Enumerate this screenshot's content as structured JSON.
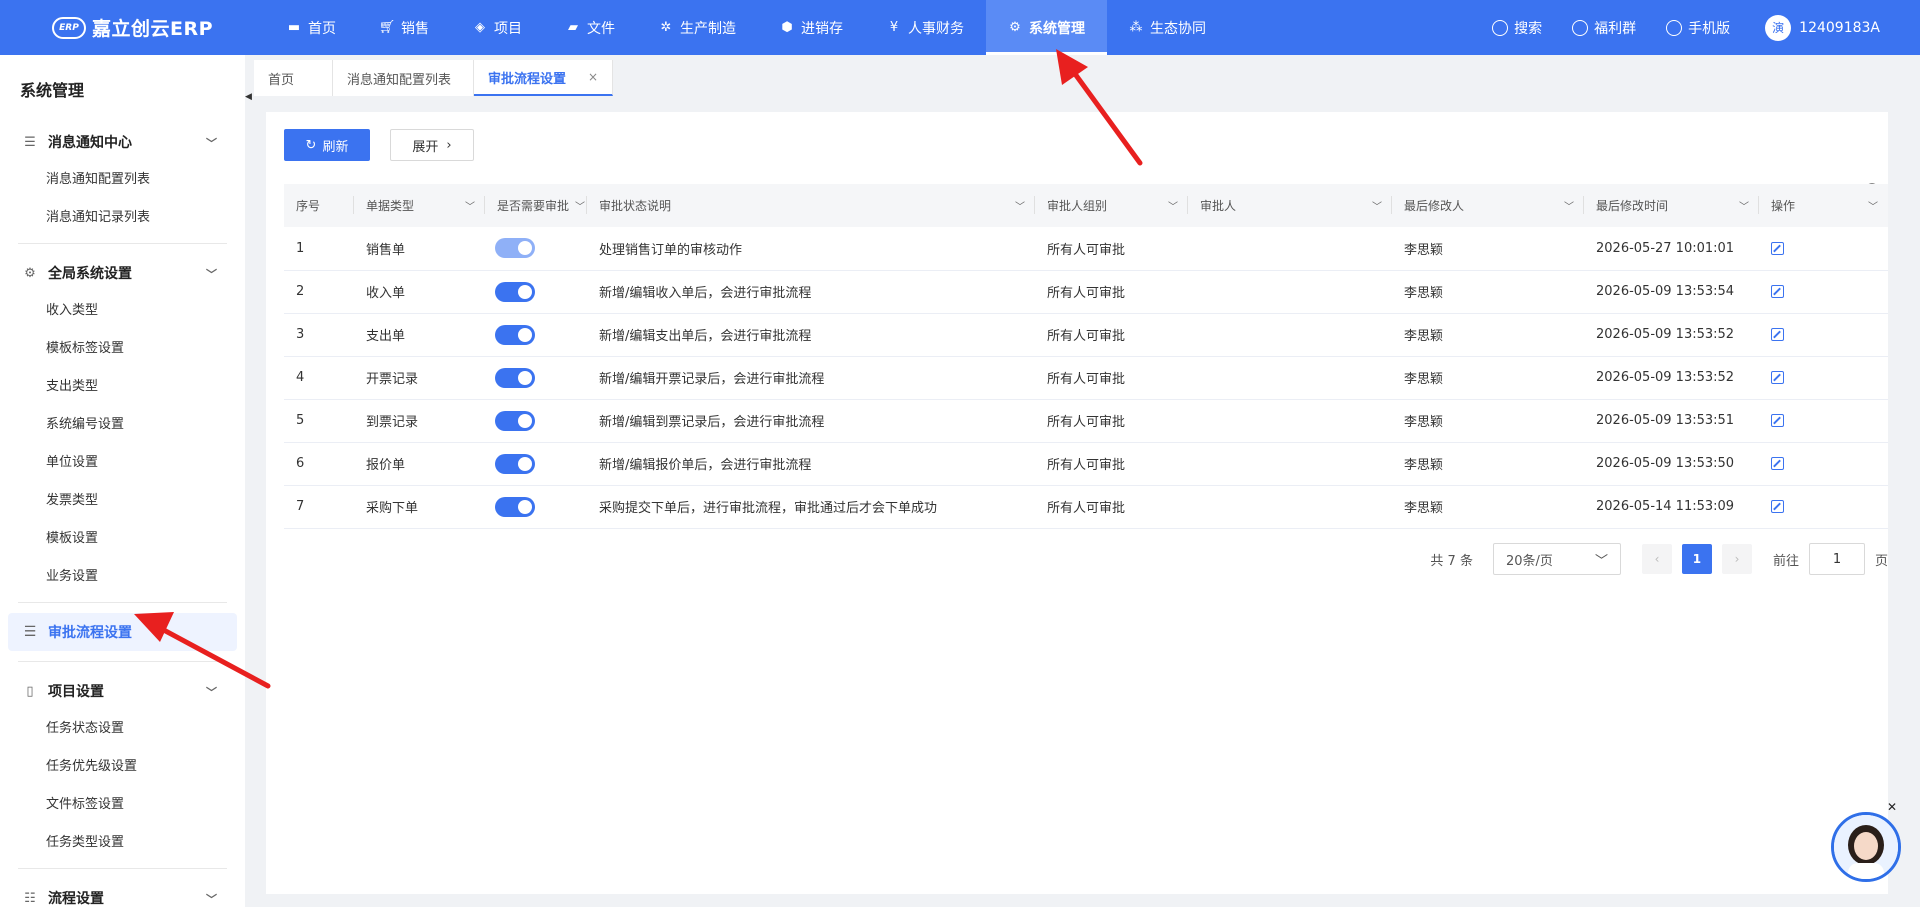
{
  "brand": {
    "logo_mark": "ERP",
    "name": "嘉立创云ERP"
  },
  "nav": [
    {
      "label": "首页",
      "icon": "monitor-icon"
    },
    {
      "label": "销售",
      "icon": "cart-icon"
    },
    {
      "label": "项目",
      "icon": "layers-icon"
    },
    {
      "label": "文件",
      "icon": "folder-icon"
    },
    {
      "label": "生产制造",
      "icon": "chip-icon"
    },
    {
      "label": "进销存",
      "icon": "box-icon"
    },
    {
      "label": "人事财务",
      "icon": "finance-icon"
    },
    {
      "label": "系统管理",
      "icon": "gear-icon",
      "active": true
    },
    {
      "label": "生态协同",
      "icon": "cluster-icon"
    }
  ],
  "topright": {
    "search": "搜索",
    "welfare": "福利群",
    "mobile": "手机版",
    "avatar": "演",
    "user": "12409183A"
  },
  "sidebar": {
    "title": "系统管理",
    "groups": [
      {
        "label": "消息通知中心",
        "items": [
          "消息通知配置列表",
          "消息通知记录列表"
        ]
      },
      {
        "label": "全局系统设置",
        "items": [
          "收入类型",
          "模板标签设置",
          "支出类型",
          "系统编号设置",
          "单位设置",
          "发票类型",
          "模板设置",
          "业务设置"
        ]
      },
      {
        "label": "审批流程设置",
        "active": true
      },
      {
        "label": "项目设置",
        "items": [
          "任务状态设置",
          "任务优先级设置",
          "文件标签设置",
          "任务类型设置"
        ]
      },
      {
        "label": "流程设置"
      }
    ]
  },
  "tabs": {
    "t1": "首页",
    "t2": "消息通知配置列表",
    "t3": "审批流程设置",
    "close": "×"
  },
  "toolbar": {
    "refresh": "刷新",
    "expand": "展开"
  },
  "table": {
    "headers": [
      "序号",
      "单据类型",
      "是否需要审批",
      "审批状态说明",
      "审批人组别",
      "审批人",
      "最后修改人",
      "最后修改时间",
      "操作"
    ],
    "rows": [
      {
        "no": "1",
        "type": "销售单",
        "on": true,
        "desc": "处理销售订单的审核动作",
        "group": "所有人可审批",
        "approver": "",
        "modifier": "李思颖",
        "time": "2026-05-27 10:01:01"
      },
      {
        "no": "2",
        "type": "收入单",
        "on": true,
        "desc": "新增/编辑收入单后，会进行审批流程",
        "group": "所有人可审批",
        "approver": "",
        "modifier": "李思颖",
        "time": "2026-05-09 13:53:54"
      },
      {
        "no": "3",
        "type": "支出单",
        "on": true,
        "desc": "新增/编辑支出单后，会进行审批流程",
        "group": "所有人可审批",
        "approver": "",
        "modifier": "李思颖",
        "time": "2026-05-09 13:53:52"
      },
      {
        "no": "4",
        "type": "开票记录",
        "on": true,
        "desc": "新增/编辑开票记录后，会进行审批流程",
        "group": "所有人可审批",
        "approver": "",
        "modifier": "李思颖",
        "time": "2026-05-09 13:53:52"
      },
      {
        "no": "5",
        "type": "到票记录",
        "on": true,
        "desc": "新增/编辑到票记录后，会进行审批流程",
        "group": "所有人可审批",
        "approver": "",
        "modifier": "李思颖",
        "time": "2026-05-09 13:53:51"
      },
      {
        "no": "6",
        "type": "报价单",
        "on": true,
        "desc": "新增/编辑报价单后，会进行审批流程",
        "group": "所有人可审批",
        "approver": "",
        "modifier": "李思颖",
        "time": "2026-05-09 13:53:50"
      },
      {
        "no": "7",
        "type": "采购下单",
        "on": true,
        "desc": "采购提交下单后，进行审批流程，审批通过后才会下单成功",
        "group": "所有人可审批",
        "approver": "",
        "modifier": "李思颖",
        "time": "2026-05-14 11:53:09"
      }
    ]
  },
  "pagination": {
    "total": "共 7 条",
    "page_size": "20条/页",
    "current": "1",
    "goto_label": "前往",
    "goto_value": "1",
    "page_unit": "页"
  },
  "colors": {
    "primary": "#3b73f0",
    "arrow": "#e8201f"
  }
}
